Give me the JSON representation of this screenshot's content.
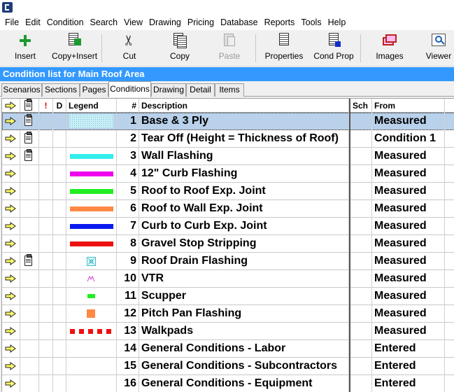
{
  "menu": [
    "File",
    "Edit",
    "Condition",
    "Search",
    "View",
    "Drawing",
    "Pricing",
    "Database",
    "Reports",
    "Tools",
    "Help"
  ],
  "toolbar": [
    {
      "id": "insert",
      "label": "Insert",
      "icon": "insert-plus-icon",
      "enabled": true
    },
    {
      "id": "copy-insert",
      "label": "Copy+Insert",
      "icon": "copy-insert-icon",
      "enabled": true
    },
    {
      "id": "cut",
      "label": "Cut",
      "icon": "scissors-icon",
      "enabled": true
    },
    {
      "id": "copy",
      "label": "Copy",
      "icon": "copy-icon",
      "enabled": true
    },
    {
      "id": "paste",
      "label": "Paste",
      "icon": "paste-icon",
      "enabled": false
    },
    {
      "id": "properties",
      "label": "Properties",
      "icon": "properties-icon",
      "enabled": true
    },
    {
      "id": "cond-prop",
      "label": "Cond Prop",
      "icon": "cond-prop-icon",
      "enabled": true
    },
    {
      "id": "images",
      "label": "Images",
      "icon": "images-icon",
      "enabled": true
    },
    {
      "id": "viewer",
      "label": "Viewer",
      "icon": "viewer-icon",
      "enabled": true
    }
  ],
  "panel_title": "Condition list for Main Roof Area",
  "tabs": [
    "Scenarios",
    "Sections",
    "Pages",
    "Conditions",
    "Drawing",
    "Detail",
    "Items"
  ],
  "active_tab": "Conditions",
  "columns": {
    "flag": "!",
    "d": "D",
    "legend": "Legend",
    "num": "#",
    "desc": "Description",
    "sch": "Sch",
    "from": "From"
  },
  "colors": {
    "title_bar": "#3399ff",
    "selected_row": "#b9d1ea",
    "arrow_fill": "#ffff66"
  },
  "rows": [
    {
      "num": "1",
      "desc": "Base & 3 Ply",
      "from": "Measured",
      "clip": true,
      "legend": {
        "type": "area",
        "color": "#c9eff8"
      },
      "selected": true
    },
    {
      "num": "2",
      "desc": "Tear Off (Height = Thickness of Roof)",
      "from": "Condition 1",
      "clip": true,
      "legend": {
        "type": "none"
      }
    },
    {
      "num": "3",
      "desc": "Wall Flashing",
      "from": "Measured",
      "clip": true,
      "legend": {
        "type": "line",
        "color": "#33eeee"
      }
    },
    {
      "num": "4",
      "desc": "12\" Curb Flashing",
      "from": "Measured",
      "clip": false,
      "legend": {
        "type": "line",
        "color": "#ee00ee"
      }
    },
    {
      "num": "5",
      "desc": "Roof to Roof Exp. Joint",
      "from": "Measured",
      "clip": false,
      "legend": {
        "type": "line",
        "color": "#22ee22"
      }
    },
    {
      "num": "6",
      "desc": "Roof to Wall Exp. Joint",
      "from": "Measured",
      "clip": false,
      "legend": {
        "type": "line",
        "color": "#ff8844"
      }
    },
    {
      "num": "7",
      "desc": "Curb to Curb Exp. Joint",
      "from": "Measured",
      "clip": false,
      "legend": {
        "type": "line",
        "color": "#0a1aee"
      }
    },
    {
      "num": "8",
      "desc": "Gravel Stop Stripping",
      "from": "Measured",
      "clip": false,
      "legend": {
        "type": "line",
        "color": "#ee1111"
      }
    },
    {
      "num": "9",
      "desc": "Roof Drain Flashing",
      "from": "Measured",
      "clip": true,
      "legend": {
        "type": "drain",
        "color": "#33bbcc"
      }
    },
    {
      "num": "10",
      "desc": "VTR",
      "from": "Measured",
      "clip": false,
      "legend": {
        "type": "vtr",
        "color": "#cc44cc"
      }
    },
    {
      "num": "11",
      "desc": "Scupper",
      "from": "Measured",
      "clip": false,
      "legend": {
        "type": "small-rect",
        "color": "#22ee22"
      }
    },
    {
      "num": "12",
      "desc": "Pitch Pan Flashing",
      "from": "Measured",
      "clip": false,
      "legend": {
        "type": "square",
        "color": "#ff8844"
      }
    },
    {
      "num": "13",
      "desc": "Walkpads",
      "from": "Measured",
      "clip": false,
      "legend": {
        "type": "dashed",
        "color": "#ee1111"
      }
    },
    {
      "num": "14",
      "desc": "General Conditions - Labor",
      "from": "Entered",
      "clip": false,
      "legend": {
        "type": "none"
      }
    },
    {
      "num": "15",
      "desc": "General Conditions - Subcontractors",
      "from": "Entered",
      "clip": false,
      "legend": {
        "type": "none"
      }
    },
    {
      "num": "16",
      "desc": "General Conditions - Equipment",
      "from": "Entered",
      "clip": false,
      "legend": {
        "type": "none"
      }
    }
  ]
}
